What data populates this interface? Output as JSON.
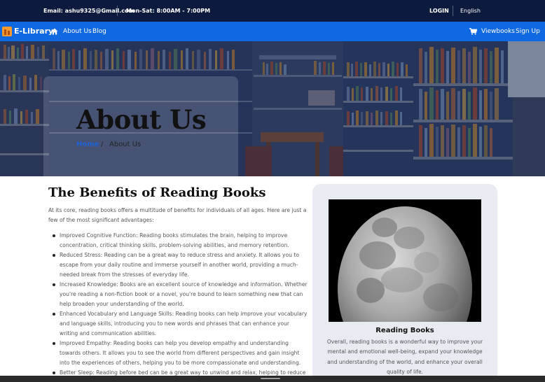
{
  "topbar": {
    "email": "Email: ashu9325@Gmail.com",
    "hours": "Mon-Sat: 8:00AM - 7:00PM",
    "login": "LOGIN",
    "language": "English"
  },
  "navbar": {
    "brand": "E-Library",
    "links": {
      "about": "About Us",
      "blog": "Blog",
      "viewbooks": "Viewbooks",
      "signup": "Sign Up"
    },
    "icons": [
      "home-icon",
      "cart-icon"
    ]
  },
  "hero": {
    "title": "About Us",
    "breadcrumb": {
      "home": "Home",
      "separator": "/",
      "current": "About Us"
    }
  },
  "main": {
    "heading": "The Benefits of Reading Books",
    "intro": "At its core, reading books offers a multitude of benefits for individuals of all ages. Here are just a few of the most significant advantages:",
    "benefits": [
      "Improved Cognitive Function: Reading books stimulates the brain, helping to improve concentration, critical thinking skills, problem-solving abilities, and memory retention.",
      "Reduced Stress: Reading can be a great way to reduce stress and anxiety. It allows you to escape from your daily routine and immerse yourself in another world, providing a much-needed break from the stresses of everyday life.",
      "Increased Knowledge: Books are an excellent source of knowledge and information. Whether you're reading a non-fiction book or a novel, you're bound to learn something new that can help broaden your understanding of the world.",
      "Enhanced Vocabulary and Language Skills: Reading books can help improve your vocabulary and language skills, introducing you to new words and phrases that can enhance your writing and communication abilities.",
      "Improved Empathy: Reading books can help you develop empathy and understanding towards others. It allows you to see the world from different perspectives and gain insight into the experiences of others, helping you to be more compassionate and understanding.",
      "Better Sleep: Reading before bed can be a great way to unwind and relax, helping to reduce"
    ]
  },
  "card": {
    "title": "Reading Books",
    "text": "Overall, reading books is a wonderful way to improve your mental and emotional well-being, expand your knowledge and understanding of the world, and enhance your overall quality of life."
  },
  "colors": {
    "topbar": "#0c1a3d",
    "navbar": "#1069e0",
    "link": "#1d63d6",
    "card": "#e9ebf2"
  }
}
